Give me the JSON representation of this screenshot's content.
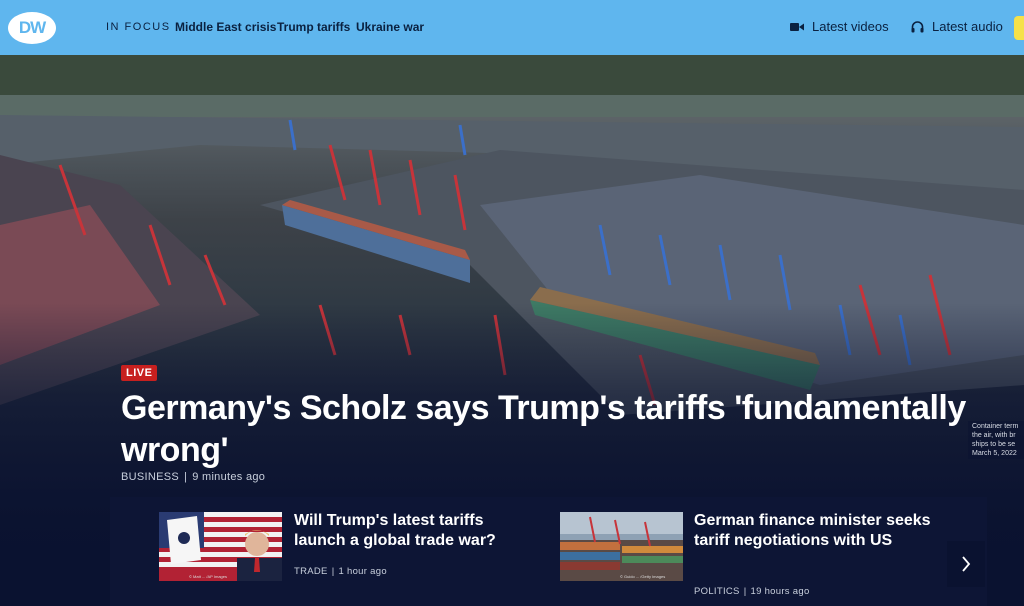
{
  "header": {
    "logo_text": "DW",
    "in_focus_label": "IN FOCUS",
    "topics": [
      "Middle East crisis",
      "Trump tariffs",
      "Ukraine war"
    ],
    "latest_videos": "Latest videos",
    "latest_audio": "Latest audio",
    "colors": {
      "bar": "#5fb6ee",
      "text": "#0a2140",
      "accent": "#f5e14a"
    }
  },
  "hero": {
    "live_badge": "LIVE",
    "headline": "Germany's Scholz says Trump's tariffs 'fundamentally wrong'",
    "category": "BUSINESS",
    "time": "9 minutes ago",
    "caption_lines": [
      "Container term",
      "the air, with br",
      "ships to be se",
      "March 5, 2022"
    ]
  },
  "cards": [
    {
      "title": "Will Trump's latest tariffs launch a global trade war?",
      "category": "TRADE",
      "time": "1 hour ago",
      "image_credit": "© Matt ... /AP Images"
    },
    {
      "title": "German finance minister seeks tariff negotiations with US",
      "category": "POLITICS",
      "time": "19 hours ago",
      "image_credit": "© Guido ... /Getty Images"
    }
  ],
  "icons": {
    "video": "video-camera-icon",
    "audio": "headphones-icon",
    "next": "chevron-right-icon"
  }
}
